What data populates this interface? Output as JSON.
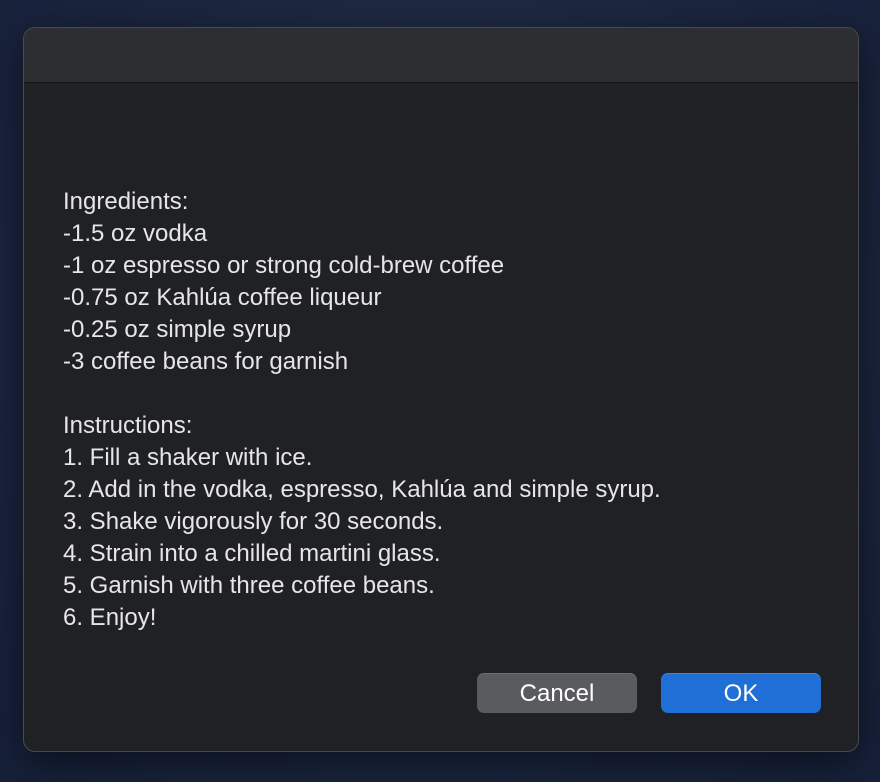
{
  "dialog": {
    "title": "",
    "ingredients": {
      "heading": "Ingredients:",
      "items": [
        "-1.5 oz vodka",
        "-1 oz espresso or strong cold-brew coffee",
        "-0.75 oz Kahlúa coffee liqueur",
        "-0.25 oz simple syrup",
        "-3 coffee beans for garnish"
      ]
    },
    "instructions": {
      "heading": "Instructions:",
      "steps": [
        "1. Fill a shaker with ice.",
        "2. Add in the vodka, espresso, Kahlúa and simple syrup.",
        "3. Shake vigorously for 30 seconds.",
        "4. Strain into a chilled martini glass.",
        "5. Garnish with three coffee beans.",
        "6. Enjoy!"
      ]
    },
    "buttons": {
      "cancel_label": "Cancel",
      "ok_label": "OK"
    }
  },
  "colors": {
    "dialog_background": "#202124",
    "titlebar_background": "#2d2e31",
    "ok_button": "#1f6fd6",
    "cancel_button": "#5a5b5e",
    "text": "#e6e6e6"
  }
}
